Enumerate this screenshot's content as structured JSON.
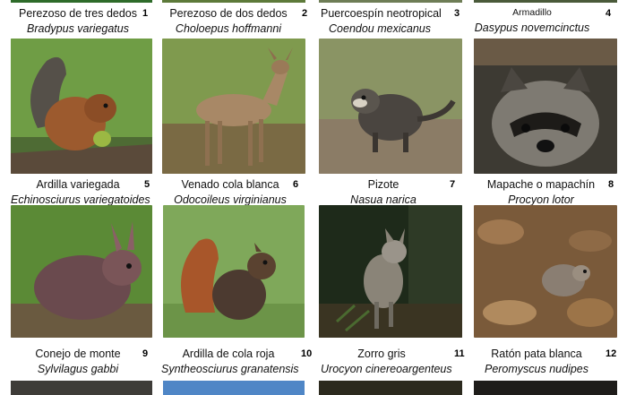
{
  "panels": [
    {
      "number": "1",
      "common": "Perezoso de tres dedos",
      "scientific": "Bradypus variegatus"
    },
    {
      "number": "2",
      "common": "Perezoso de dos dedos",
      "scientific": "Choloepus hoffmanni"
    },
    {
      "number": "3",
      "common": "Puercoespín neotropical",
      "scientific": "Coendou mexicanus"
    },
    {
      "number": "4",
      "common": "Armadillo",
      "scientific": "Dasypus novemcinctus"
    },
    {
      "number": "5",
      "common": "Ardilla variegada",
      "scientific": "Echinosciurus variegatoides"
    },
    {
      "number": "6",
      "common": "Venado cola blanca",
      "scientific": "Odocoileus virginianus"
    },
    {
      "number": "7",
      "common": "Pizote",
      "scientific": "Nasua narica"
    },
    {
      "number": "8",
      "common": "Mapache o mapachín",
      "scientific": "Procyon lotor"
    },
    {
      "number": "9",
      "common": "Conejo de monte",
      "scientific": "Sylvilagus gabbi"
    },
    {
      "number": "10",
      "common": "Ardilla de cola roja",
      "scientific": "Syntheosciurus granatensis"
    },
    {
      "number": "11",
      "common": "Zorro gris",
      "scientific": "Urocyon cinereoargenteus"
    },
    {
      "number": "12",
      "common": "Ratón pata blanca",
      "scientific": "Peromyscus nudipes"
    }
  ]
}
